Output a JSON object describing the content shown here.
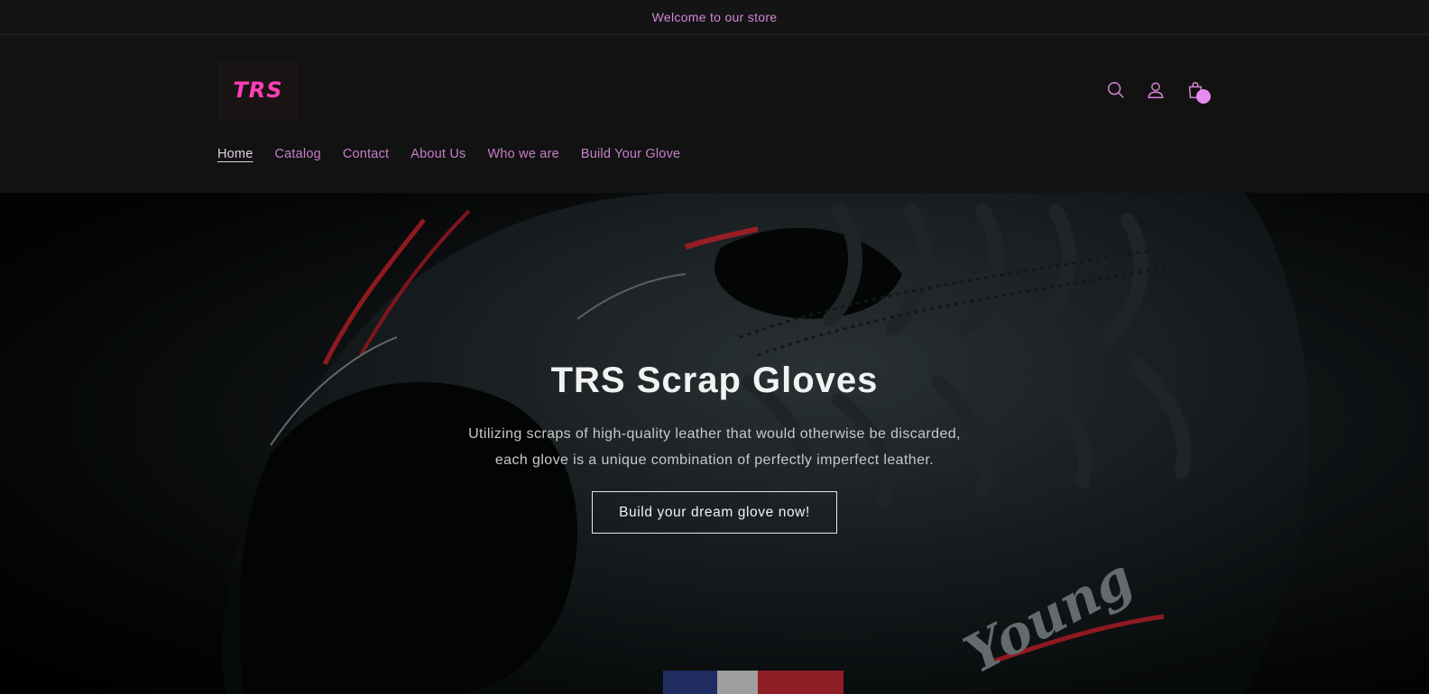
{
  "announcement": {
    "text": "Welcome to our store"
  },
  "brand": {
    "logo_text": "TRS",
    "accent": "#ff3fb4"
  },
  "header": {
    "icons": [
      "search-icon",
      "account-icon",
      "cart-icon"
    ],
    "cart_badge_color": "#e58cf0"
  },
  "nav": {
    "items": [
      {
        "label": "Home",
        "active": true
      },
      {
        "label": "Catalog"
      },
      {
        "label": "Contact"
      },
      {
        "label": "About Us"
      },
      {
        "label": "Who we are"
      },
      {
        "label": "Build Your Glove"
      }
    ],
    "color": "#c77fcb"
  },
  "hero": {
    "title": "TRS Scrap Gloves",
    "subtitle_line1": "Utilizing scraps of high-quality leather that would otherwise be discarded,",
    "subtitle_line2": "each glove is a unique combination of perfectly imperfect leather.",
    "button_label": "Build your dream glove now!",
    "glove_stamp": "Young"
  }
}
